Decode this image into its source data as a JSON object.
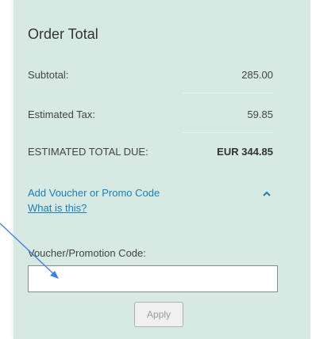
{
  "order": {
    "title": "Order Total",
    "subtotal_label": "Subtotal:",
    "subtotal_value": "285.00",
    "tax_label": "Estimated Tax:",
    "tax_value": "59.85",
    "total_label": "ESTIMATED TOTAL DUE:",
    "total_value": "EUR 344.85"
  },
  "voucher": {
    "toggle_label": "Add Voucher or Promo Code",
    "what_link": "What is this?",
    "code_label": "Voucher/Promotion Code:",
    "input_value": "",
    "input_placeholder": "",
    "apply_label": "Apply"
  },
  "colors": {
    "panel_bg": "#d6e9e2",
    "link": "#1a7fb8",
    "pointer_arrow": "#3b7fe0"
  },
  "icons": {
    "collapse": "chevron-up-icon",
    "annotation": "arrow-pointer-icon"
  }
}
